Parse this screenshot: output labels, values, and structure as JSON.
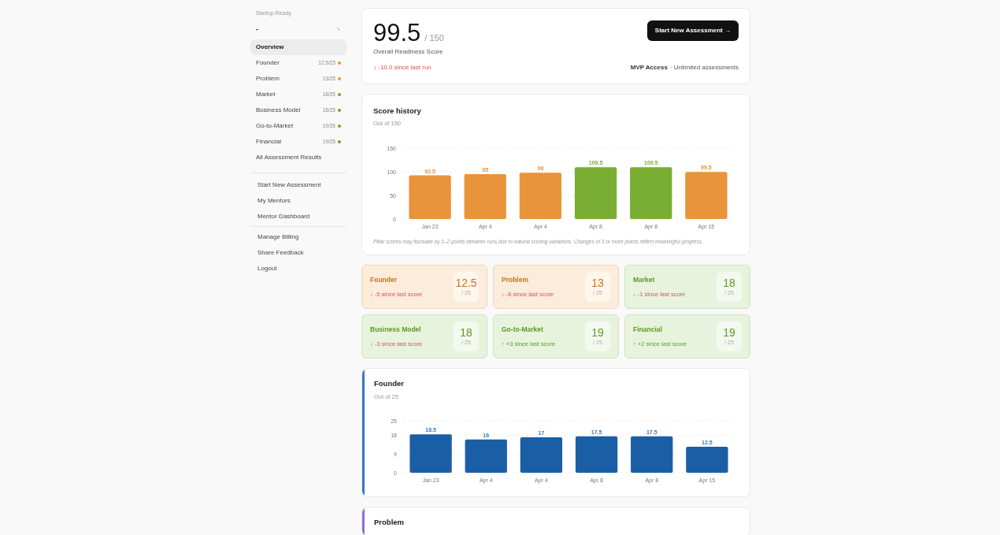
{
  "sidebar": {
    "brand": "Startup.Ready.",
    "project": "-",
    "nav": [
      {
        "label": "Overview",
        "selected": true
      },
      {
        "label": "Founder",
        "score": "12.5/25",
        "color": "#e8943a",
        "selected": false
      },
      {
        "label": "Problem",
        "score": "13/25",
        "color": "#e8943a",
        "selected": false
      },
      {
        "label": "Market",
        "score": "18/25",
        "color": "#6aa532",
        "selected": false
      },
      {
        "label": "Business Model",
        "score": "18/25",
        "color": "#6aa532",
        "selected": false
      },
      {
        "label": "Go-to-Market",
        "score": "19/25",
        "color": "#6aa532",
        "selected": false
      },
      {
        "label": "Financial",
        "score": "19/25",
        "color": "#6aa532",
        "selected": false
      },
      {
        "label": "All Assessment Results",
        "selected": false
      }
    ],
    "actions": [
      "Start New Assessment",
      "My Mentors",
      "Mentor Dashboard"
    ],
    "account": [
      "Manage Billing",
      "Share Feedback",
      "Logout"
    ]
  },
  "overview": {
    "score": "99.5",
    "max": "/ 150",
    "label": "Overall Readiness Score",
    "delta": "↓ -10.0 since last run",
    "button": "Start New Assessment →",
    "plan": "MVP Access",
    "plan_note": "· Unlimited assessments"
  },
  "score_history": {
    "title": "Score history",
    "subtitle": "Out of 150",
    "note": "Pillar scores may fluctuate by 1–2 points between runs due to natural scoring variations. Changes of 3 or more points reflect meaningful progress.",
    "chart_data": {
      "type": "bar",
      "categories": [
        "Jan 23",
        "Apr 4",
        "Apr 4",
        "Apr 8",
        "Apr 8",
        "Apr 15"
      ],
      "stacked": true,
      "data_labels": true,
      "ylim": [
        0,
        150
      ],
      "yticks": [
        0,
        50,
        100,
        150
      ],
      "series": [
        {
          "color": "#e8943a",
          "values": [
            92.5,
            95,
            98,
            null,
            null,
            99.5
          ]
        },
        {
          "color": "#7aae32",
          "values": [
            null,
            null,
            null,
            109.5,
            109.5,
            null
          ]
        }
      ]
    }
  },
  "pillars": [
    {
      "name": "Founder",
      "on_track": false,
      "delta": "↓ -5 since last score",
      "improved": false,
      "score": "12.5",
      "max": "/ 25"
    },
    {
      "name": "Problem",
      "on_track": false,
      "delta": "↓ -6 since last score",
      "improved": false,
      "score": "13",
      "max": "/ 25"
    },
    {
      "name": "Market",
      "on_track": true,
      "delta": "↓ -1 since last score",
      "improved": false,
      "score": "18",
      "max": "/ 25"
    },
    {
      "name": "Business Model",
      "on_track": true,
      "delta": "↓ -3 since last score",
      "improved": false,
      "score": "18",
      "max": "/ 25"
    },
    {
      "name": "Go-to-Market",
      "on_track": true,
      "delta": "↑ +3 since last score",
      "improved": true,
      "score": "19",
      "max": "/ 25"
    },
    {
      "name": "Financial",
      "on_track": true,
      "delta": "↑ +2 since last score",
      "improved": true,
      "score": "19",
      "max": "/ 25"
    }
  ],
  "pillar_charts": [
    {
      "title": "Founder",
      "subtitle": "Out of 25",
      "color": "#3b78c4",
      "chart_data": {
        "type": "bar",
        "categories": [
          "Jan 23",
          "Apr 4",
          "Apr 4",
          "Apr 8",
          "Apr 8",
          "Apr 15"
        ],
        "data_labels": true,
        "ylim": [
          0,
          25
        ],
        "yticks": [
          0,
          9,
          18,
          25
        ],
        "series": [
          {
            "color": "#1a5ea6",
            "values": [
              18.5,
              16,
              17,
              17.5,
              17.5,
              12.5
            ]
          }
        ]
      }
    },
    {
      "title": "Problem",
      "color": "#8b6fd0"
    }
  ]
}
